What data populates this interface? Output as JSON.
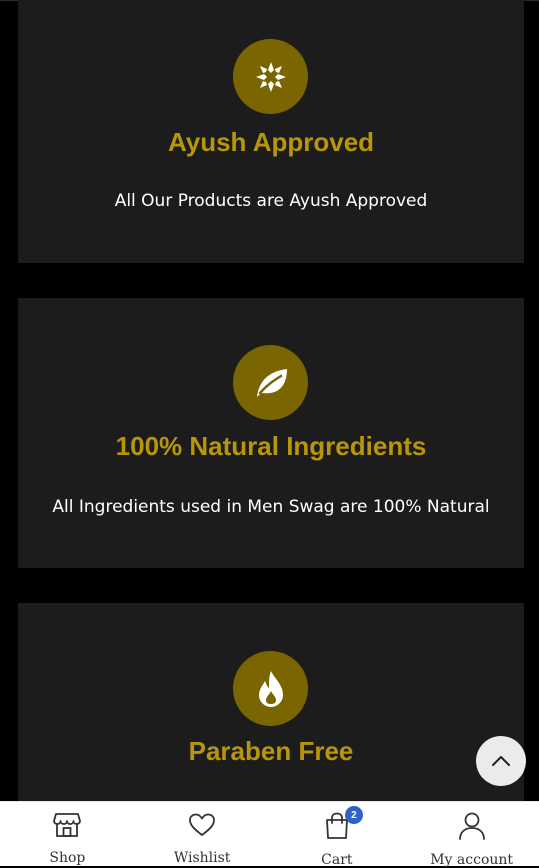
{
  "features": [
    {
      "icon": "ayush-emblem-icon",
      "title": "Ayush Approved",
      "description": "All Our Products are Ayush Approved"
    },
    {
      "icon": "leaf-icon",
      "title": "100% Natural Ingredients",
      "description": "All Ingredients used in Men Swag are 100% Natural"
    },
    {
      "icon": "flame-drop-icon",
      "title": "Paraben Free",
      "description": ""
    }
  ],
  "colors": {
    "badge": "#7a6500",
    "title": "#b8960a",
    "card": "#1c1c1c",
    "cart_badge": "#2f63c7"
  },
  "bottom_nav": {
    "items": [
      {
        "label": "Shop",
        "icon": "store-icon"
      },
      {
        "label": "Wishlist",
        "icon": "heart-icon"
      },
      {
        "label": "Cart",
        "icon": "bag-icon"
      },
      {
        "label": "My account",
        "icon": "user-icon"
      }
    ],
    "cart_count": "2"
  },
  "scroll_top": {
    "icon": "chevron-up-icon"
  }
}
